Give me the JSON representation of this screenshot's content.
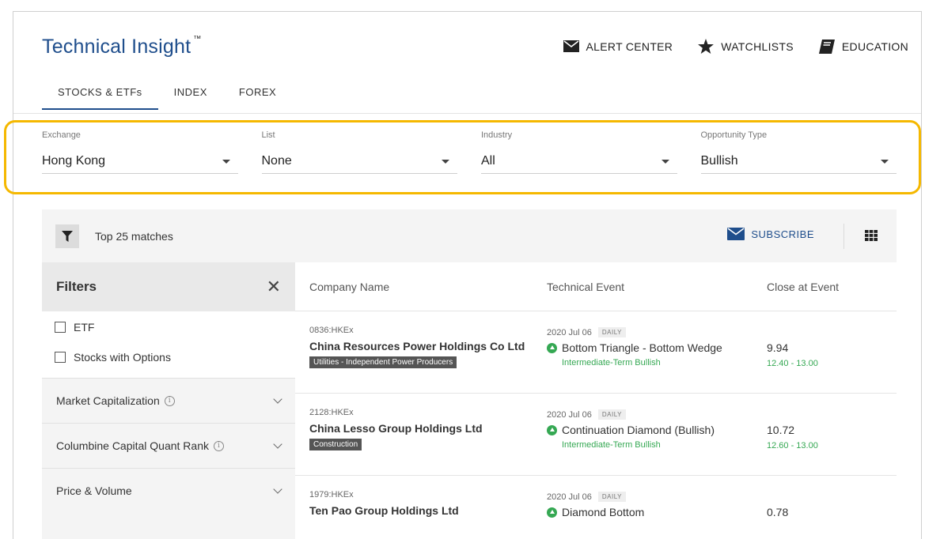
{
  "header": {
    "title": "Technical Insight",
    "trademark": "™",
    "nav": [
      {
        "label": "ALERT CENTER",
        "icon": "envelope-icon"
      },
      {
        "label": "WATCHLISTS",
        "icon": "star-icon"
      },
      {
        "label": "EDUCATION",
        "icon": "book-icon"
      }
    ]
  },
  "tabs": [
    {
      "label": "STOCKS & ETFs",
      "active": true
    },
    {
      "label": "INDEX",
      "active": false
    },
    {
      "label": "FOREX",
      "active": false
    }
  ],
  "selectors": [
    {
      "label": "Exchange",
      "value": "Hong Kong"
    },
    {
      "label": "List",
      "value": "None"
    },
    {
      "label": "Industry",
      "value": "All"
    },
    {
      "label": "Opportunity Type",
      "value": "Bullish"
    }
  ],
  "results": {
    "matches_label": "Top 25 matches",
    "subscribe_label": "SUBSCRIBE"
  },
  "filters": {
    "title": "Filters",
    "checkboxes": [
      "ETF",
      "Stocks with Options"
    ],
    "sections": [
      {
        "label": "Market Capitalization",
        "info": true
      },
      {
        "label": "Columbine Capital Quant Rank",
        "info": true
      },
      {
        "label": "Price & Volume",
        "info": false
      }
    ]
  },
  "table": {
    "columns": [
      "Company Name",
      "Technical Event",
      "Close at Event"
    ],
    "rows": [
      {
        "ticker": "0836:HKEx",
        "company": "China Resources Power Holdings Co Ltd",
        "sector": "Utilities - Independent Power Producers",
        "date": "2020 Jul 06",
        "frequency": "DAILY",
        "event": "Bottom Triangle - Bottom Wedge",
        "term": "Intermediate-Term Bullish",
        "close": "9.94",
        "range": "12.40 - 13.00"
      },
      {
        "ticker": "2128:HKEx",
        "company": "China Lesso Group Holdings Ltd",
        "sector": "Construction",
        "date": "2020 Jul 06",
        "frequency": "DAILY",
        "event": "Continuation Diamond (Bullish)",
        "term": "Intermediate-Term Bullish",
        "close": "10.72",
        "range": "12.60 - 13.00"
      },
      {
        "ticker": "1979:HKEx",
        "company": "Ten Pao Group Holdings Ltd",
        "sector": "",
        "date": "2020 Jul 06",
        "frequency": "DAILY",
        "event": "Diamond Bottom",
        "term": "",
        "close": "0.78",
        "range": ""
      }
    ]
  },
  "colors": {
    "brand": "#1f4e8c",
    "bullish": "#35a853",
    "highlight": "#f5b800"
  }
}
